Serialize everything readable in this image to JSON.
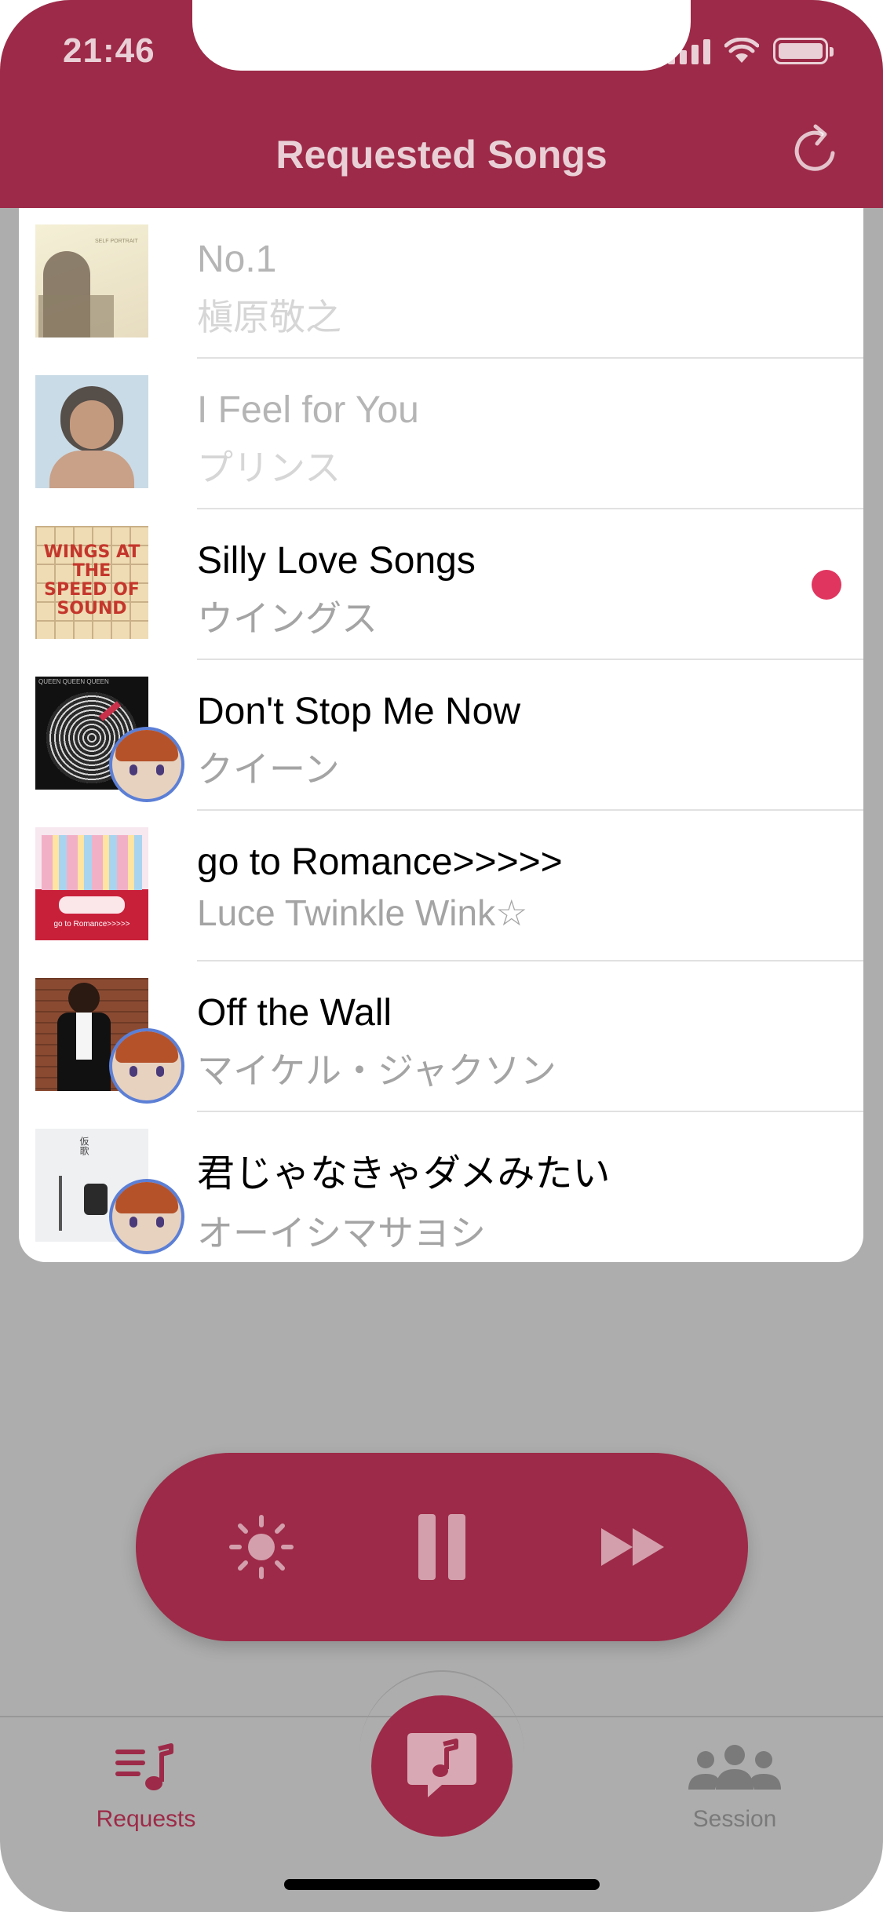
{
  "status_bar": {
    "time": "21:46"
  },
  "header": {
    "title": "Requested Songs"
  },
  "songs": [
    {
      "title": "No.1",
      "artist": "槇原敬之",
      "state": "played",
      "has_avatar": false
    },
    {
      "title": "I Feel for You",
      "artist": "プリンス",
      "state": "played",
      "has_avatar": false
    },
    {
      "title": "Silly Love Songs",
      "artist": "ウイングス",
      "state": "playing",
      "has_avatar": false
    },
    {
      "title": "Don't Stop Me Now",
      "artist": "クイーン",
      "state": "queued",
      "has_avatar": true
    },
    {
      "title": "go to Romance>>>>>",
      "artist": "Luce Twinkle Wink☆",
      "state": "queued",
      "has_avatar": false
    },
    {
      "title": "Off the Wall",
      "artist": "マイケル・ジャクソン",
      "state": "queued",
      "has_avatar": true
    },
    {
      "title": "君じゃなきゃダメみたい",
      "artist": "オーイシマサヨシ",
      "state": "queued",
      "has_avatar": true
    }
  ],
  "album_art": [
    {
      "text": "SELF PORTRAIT"
    },
    {
      "text": ""
    },
    {
      "text": "WINGS AT THE SPEED OF SOUND"
    },
    {
      "text": "QUEEN QUEEN QUEEN"
    },
    {
      "text": "go to Romance>>>>>"
    },
    {
      "text": ""
    },
    {
      "text": "仮歌"
    }
  ],
  "player": {
    "controls": [
      "brightness-icon",
      "pause-icon",
      "fast-forward-icon"
    ]
  },
  "tabs": {
    "requests": "Requests",
    "session": "Session"
  },
  "colors": {
    "accent": "#9d2a48",
    "now_playing_dot": "#e0355f",
    "overlay": "#adadad"
  }
}
